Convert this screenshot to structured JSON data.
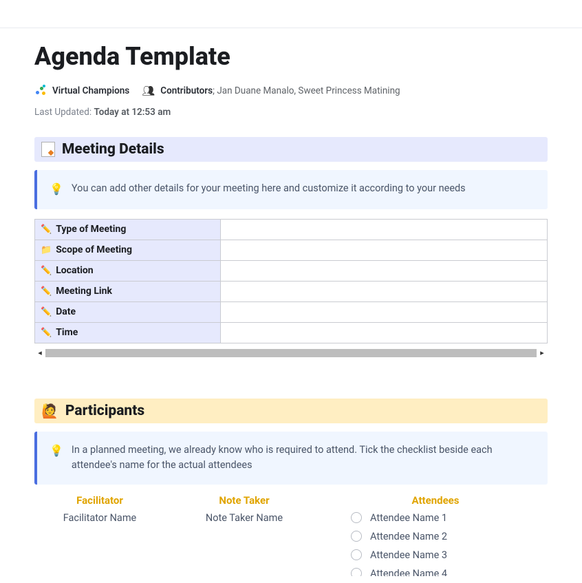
{
  "title": "Agenda Template",
  "org": "Virtual Champions",
  "contributors_label": "Contributors",
  "contributors": "Jan Duane Manalo, Sweet Princess Matining",
  "last_updated_label": "Last Updated:",
  "last_updated_value": "Today at 12:53 am",
  "meeting_details": {
    "heading": "Meeting Details",
    "hint": "You can add other details for your meeting here and customize it according to your needs",
    "rows": [
      {
        "icon": "pen",
        "label": "Type of Meeting",
        "value": ""
      },
      {
        "icon": "folder",
        "label": "Scope of Meeting",
        "value": ""
      },
      {
        "icon": "pen",
        "label": "Location",
        "value": ""
      },
      {
        "icon": "pen",
        "label": "Meeting Link",
        "value": ""
      },
      {
        "icon": "pen",
        "label": "Date",
        "value": ""
      },
      {
        "icon": "pen",
        "label": "Time",
        "value": ""
      }
    ]
  },
  "participants": {
    "heading": "Participants",
    "hint": "In a planned meeting, we already know who is required to attend. Tick the checklist beside each attendee's name for the actual attendees",
    "facilitator_heading": "Facilitator",
    "facilitator": "Facilitator Name",
    "notetaker_heading": "Note Taker",
    "notetaker": "Note Taker Name",
    "attendees_heading": "Attendees",
    "attendees": [
      "Attendee Name 1",
      "Attendee Name 2",
      "Attendee Name 3",
      "Attendee Name 4"
    ]
  }
}
